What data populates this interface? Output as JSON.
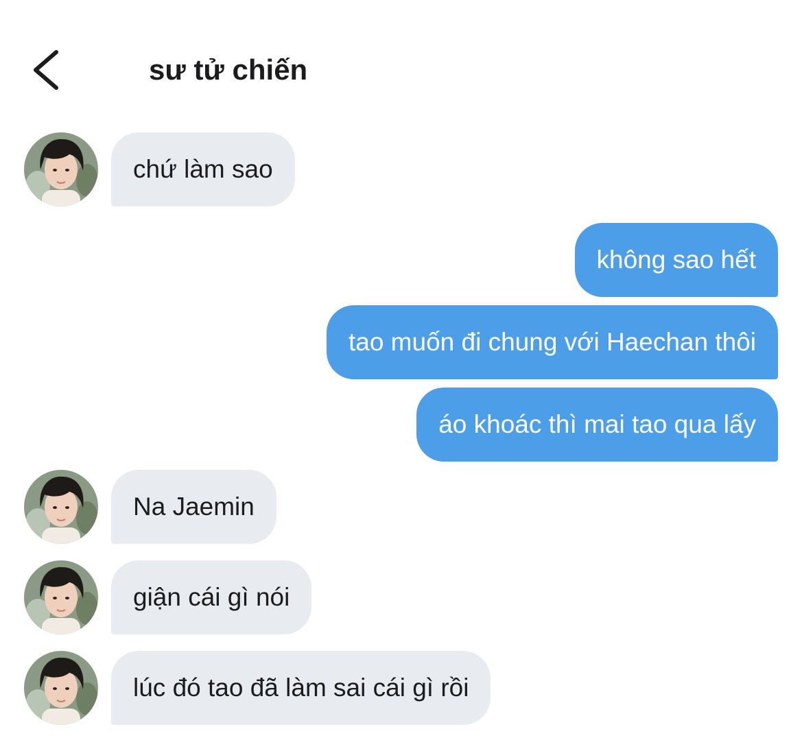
{
  "header": {
    "title": "sư tử chiến",
    "back_icon": "chevron-left-icon"
  },
  "colors": {
    "incoming_bubble": "#e8ecf0",
    "outgoing_bubble": "#4c9ee8",
    "outgoing_text": "#ffffff",
    "incoming_text": "#1c1c1e"
  },
  "messages": [
    {
      "direction": "incoming",
      "text": "chứ làm sao",
      "has_avatar": true
    },
    {
      "direction": "outgoing",
      "text": "không sao hết"
    },
    {
      "direction": "outgoing",
      "text": "tao muốn đi chung với Haechan thôi"
    },
    {
      "direction": "outgoing",
      "text": "áo khoác thì mai tao qua lấy"
    },
    {
      "direction": "incoming",
      "text": "Na Jaemin",
      "has_avatar": true
    },
    {
      "direction": "incoming",
      "text": "giận cái gì nói",
      "has_avatar": true
    },
    {
      "direction": "incoming",
      "text": "lúc đó tao đã làm sai cái gì rồi",
      "has_avatar": true
    }
  ]
}
